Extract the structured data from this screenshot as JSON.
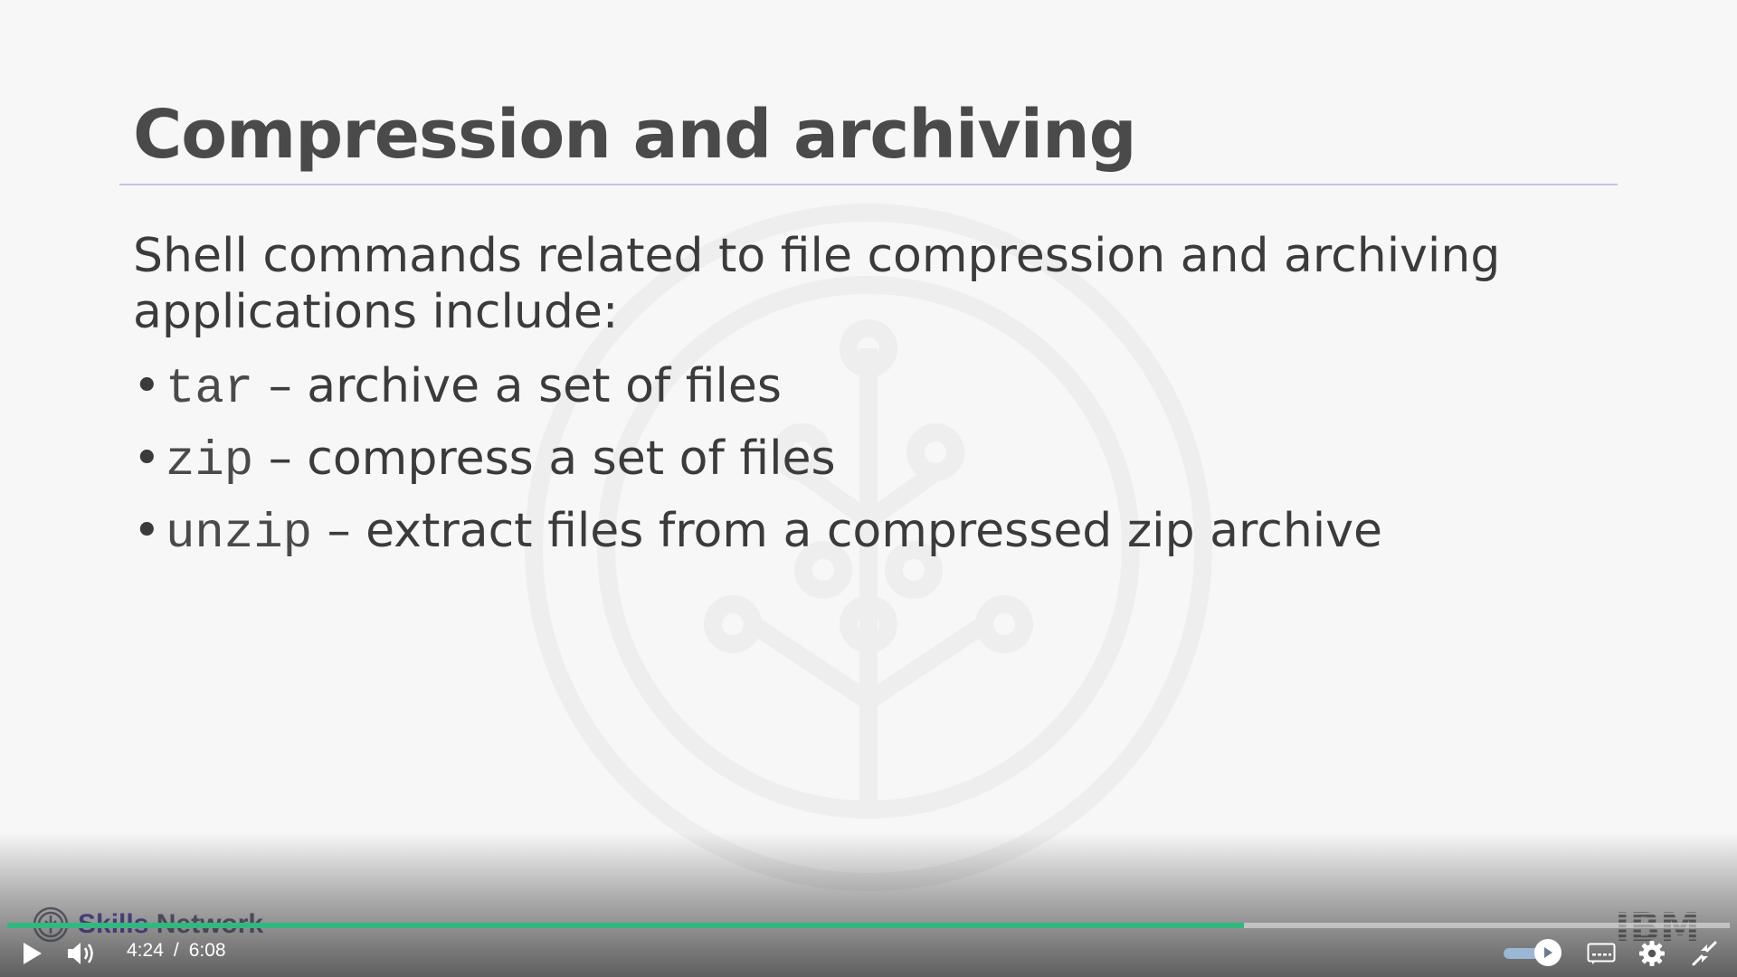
{
  "slide": {
    "title": "Compression and archiving",
    "intro": "Shell commands related to file compression and archiving applications include:",
    "bullets": [
      {
        "command": "tar",
        "description": "– archive a set of files"
      },
      {
        "command": "zip",
        "description": "– compress a set of files"
      },
      {
        "command": "unzip",
        "description": "– extract files from a compressed zip archive"
      }
    ]
  },
  "branding": {
    "network_word1": "Skills",
    "network_word2": "Network",
    "company": "IBM"
  },
  "player": {
    "current_time": "4:24",
    "separator": "/",
    "duration": "6:08",
    "progress_fraction": 0.718,
    "accent_color": "#2fb97f",
    "icons": [
      "play-icon",
      "volume-icon",
      "speed-icon",
      "captions-icon",
      "gear-icon",
      "exit-fullscreen-icon"
    ]
  }
}
